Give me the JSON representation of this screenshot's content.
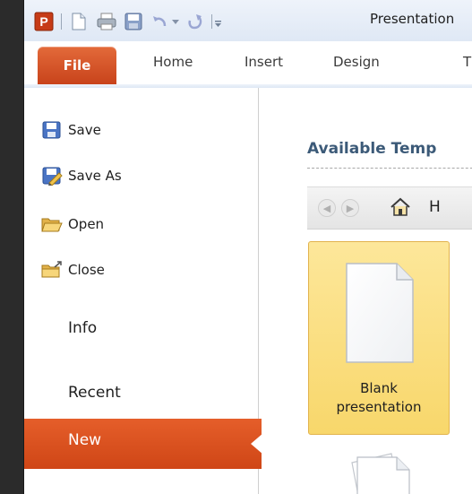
{
  "window": {
    "title": "Presentation"
  },
  "quick_access": {
    "icons": [
      "powerpoint-logo-icon",
      "new-document-icon",
      "print-icon",
      "save-icon",
      "undo-icon",
      "dropdown-icon",
      "redo-icon",
      "customize-icon"
    ]
  },
  "ribbon": {
    "tabs": [
      "File",
      "Home",
      "Insert",
      "Design",
      "T"
    ]
  },
  "backstage": {
    "commands": [
      {
        "label": "Save",
        "icon": "save-icon"
      },
      {
        "label": "Save As",
        "icon": "save-as-icon"
      },
      {
        "label": "Open",
        "icon": "open-folder-icon"
      },
      {
        "label": "Close",
        "icon": "close-folder-icon"
      }
    ],
    "tabs": [
      "Info",
      "Recent",
      "New"
    ],
    "selected_tab": "New"
  },
  "content": {
    "heading": "Available Temp",
    "nav_home_label": "H",
    "templates": [
      {
        "label": "Blank presentation",
        "line1": "Blank",
        "line2": "presentation",
        "selected": true
      }
    ]
  },
  "colors": {
    "file_tab": "#c8431b",
    "selected_nav": "#cf4616",
    "heading": "#3c5a78",
    "tile_selected": "#f8d76b"
  }
}
